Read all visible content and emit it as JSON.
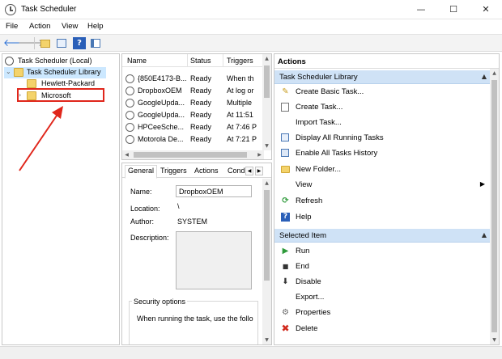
{
  "window": {
    "title": "Task Scheduler",
    "minimize": "—",
    "maximize": "☐",
    "close": "✕"
  },
  "menu": [
    "File",
    "Action",
    "View",
    "Help"
  ],
  "toolbar": {
    "back": "🡐",
    "forward": "🡒",
    "up_icon": "folder-up-icon",
    "help": "?",
    "show_hide": "pane-icon"
  },
  "tree": {
    "root": "Task Scheduler (Local)",
    "library": "Task Scheduler Library",
    "children": [
      "Hewlett-Packard",
      "Microsoft"
    ]
  },
  "task_list": {
    "columns": [
      "Name",
      "Status",
      "Triggers"
    ],
    "rows": [
      {
        "name": "{850E4173-B...",
        "status": "Ready",
        "triggers": "When th"
      },
      {
        "name": "DropboxOEM",
        "status": "Ready",
        "triggers": "At log or"
      },
      {
        "name": "GoogleUpda...",
        "status": "Ready",
        "triggers": "Multiple"
      },
      {
        "name": "GoogleUpda...",
        "status": "Ready",
        "triggers": "At 11:51"
      },
      {
        "name": "HPCeeSche...",
        "status": "Ready",
        "triggers": "At 7:46 P"
      },
      {
        "name": "Motorola De...",
        "status": "Ready",
        "triggers": "At 7:21 P"
      }
    ]
  },
  "detail": {
    "tabs": [
      "General",
      "Triggers",
      "Actions",
      "Cond"
    ],
    "fields": {
      "name_label": "Name:",
      "name_value": "DropboxOEM",
      "location_label": "Location:",
      "location_value": "\\",
      "author_label": "Author:",
      "author_value": "SYSTEM",
      "description_label": "Description:"
    },
    "security_title": "Security options",
    "security_text": "When running the task, use the follo"
  },
  "actions_pane": {
    "title": "Actions",
    "library_section": "Task Scheduler Library",
    "library_actions": [
      {
        "label": "Create Basic Task...",
        "icon": "create-basic-task-icon"
      },
      {
        "label": "Create Task...",
        "icon": "create-task-icon"
      },
      {
        "label": "Import Task...",
        "icon": ""
      },
      {
        "label": "Display All Running Tasks",
        "icon": "running-tasks-icon"
      },
      {
        "label": "Enable All Tasks History",
        "icon": "history-icon"
      },
      {
        "label": "New Folder...",
        "icon": "folder-icon"
      },
      {
        "label": "View",
        "icon": ""
      },
      {
        "label": "Refresh",
        "icon": "refresh-icon"
      },
      {
        "label": "Help",
        "icon": "help-icon"
      }
    ],
    "selected_section": "Selected Item",
    "selected_actions": [
      {
        "label": "Run",
        "icon": "run-icon"
      },
      {
        "label": "End",
        "icon": "end-icon"
      },
      {
        "label": "Disable",
        "icon": "disable-icon"
      },
      {
        "label": "Export...",
        "icon": ""
      },
      {
        "label": "Properties",
        "icon": "properties-icon"
      },
      {
        "label": "Delete",
        "icon": "delete-icon"
      }
    ]
  },
  "colors": {
    "highlight": "#e0261b",
    "section": "#cfe2f6",
    "selected": "#cce8ff"
  }
}
